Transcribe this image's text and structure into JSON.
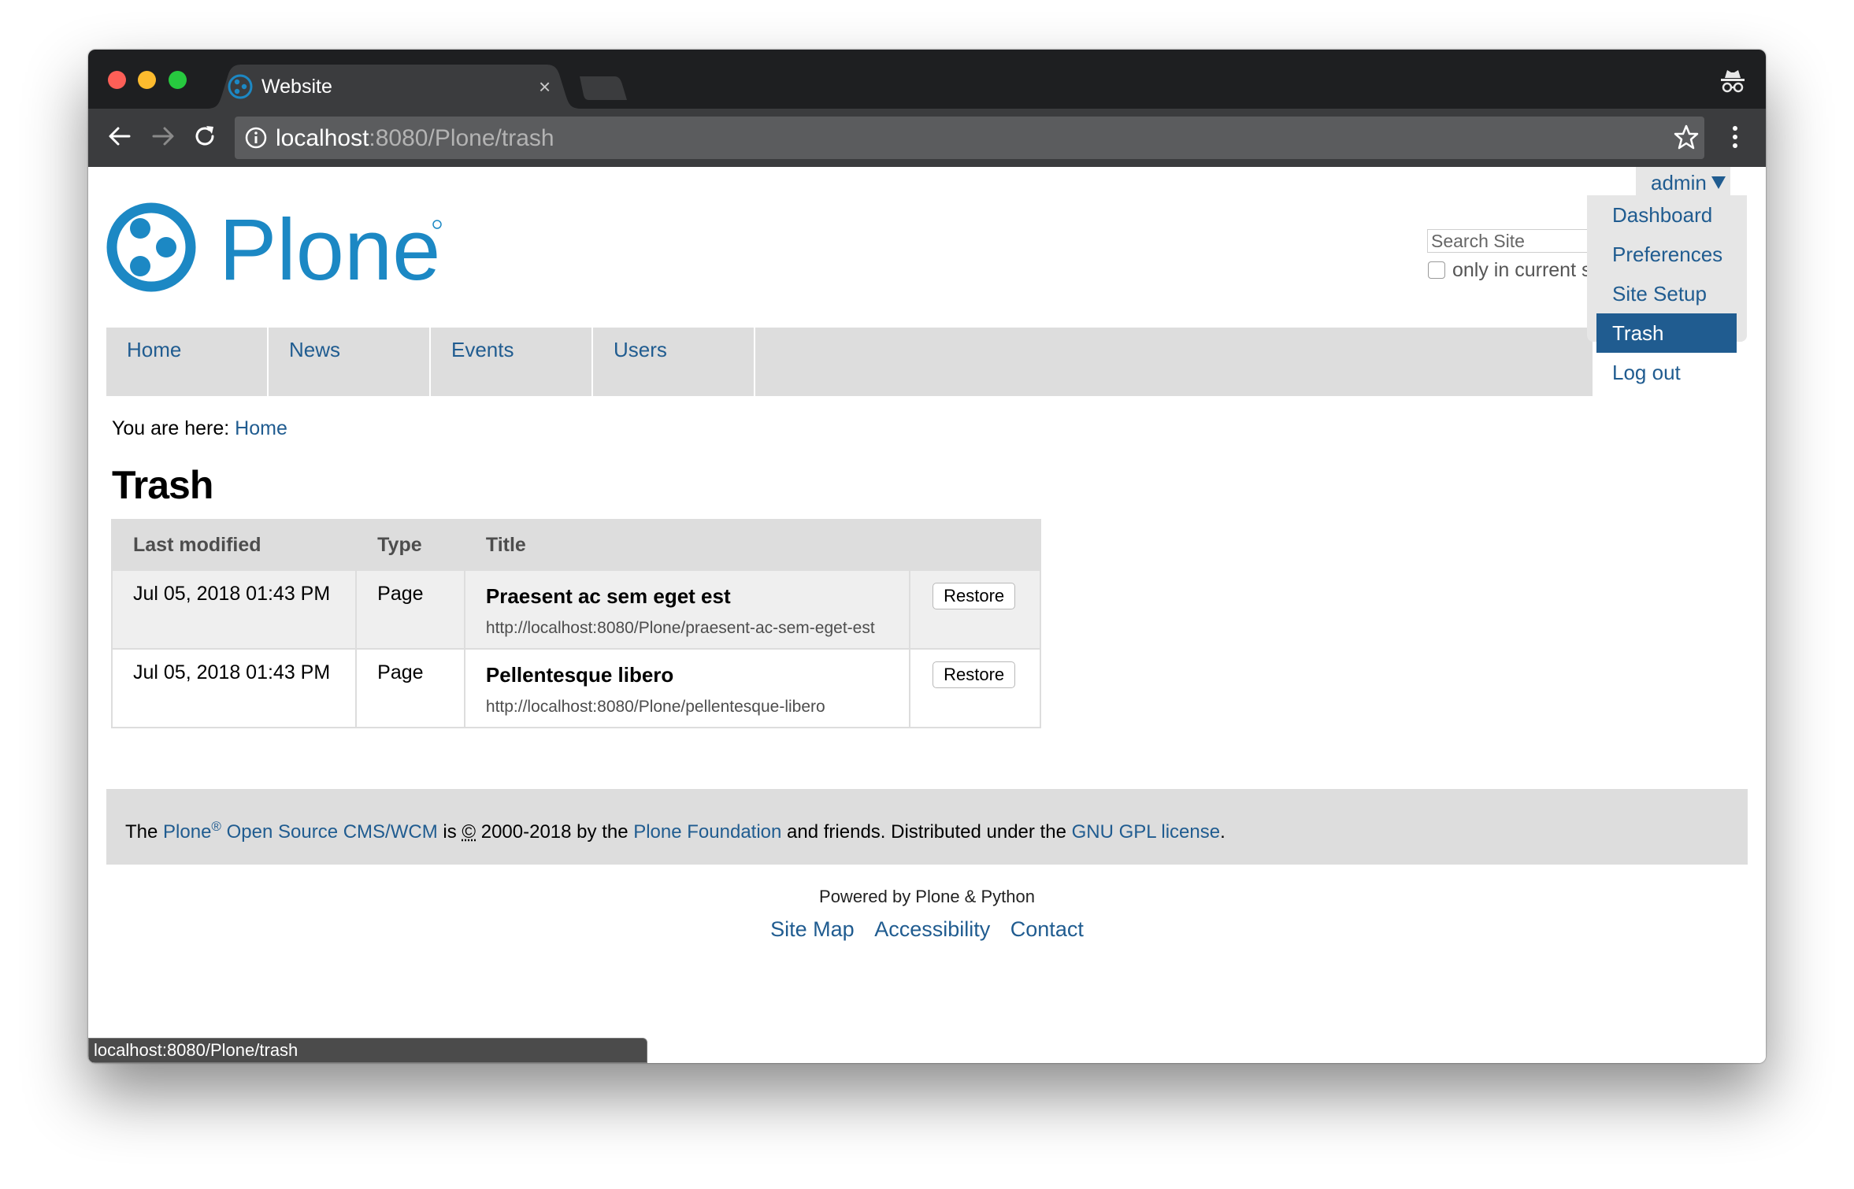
{
  "browser": {
    "tab_title": "Website",
    "tab_close": "×",
    "url_host": "localhost",
    "url_rest": ":8080/Plone/trash",
    "status_url": "localhost:8080/Plone/trash"
  },
  "user": {
    "name": "admin",
    "menu": [
      {
        "label": "Dashboard",
        "active": false
      },
      {
        "label": "Preferences",
        "active": false
      },
      {
        "label": "Site Setup",
        "active": false
      },
      {
        "label": "Trash",
        "active": true
      },
      {
        "label": "Log out",
        "active": false
      }
    ]
  },
  "search": {
    "placeholder": "Search Site",
    "only_current_label": "only in current section"
  },
  "logo_text": "Plone",
  "nav": [
    {
      "label": "Home",
      "active": true
    },
    {
      "label": "News",
      "active": false
    },
    {
      "label": "Events",
      "active": false
    },
    {
      "label": "Users",
      "active": false
    }
  ],
  "breadcrumb": {
    "prefix": "You are here:",
    "home": "Home"
  },
  "page_title": "Trash",
  "table": {
    "headers": [
      "Last modified",
      "Type",
      "Title",
      ""
    ],
    "rows": [
      {
        "modified": "Jul 05, 2018 01:43 PM",
        "type": "Page",
        "title": "Praesent ac sem eget est",
        "url": "http://localhost:8080/Plone/praesent-ac-sem-eget-est",
        "action": "Restore"
      },
      {
        "modified": "Jul 05, 2018 01:43 PM",
        "type": "Page",
        "title": "Pellentesque libero",
        "url": "http://localhost:8080/Plone/pellentesque-libero",
        "action": "Restore"
      }
    ]
  },
  "footer": {
    "t1": "The ",
    "plone": "Plone",
    "reg": "®",
    "oss": "Open Source CMS/WCM",
    "t2": " is ",
    "copy": "©",
    "t3": " 2000-2018 by the ",
    "foundation": "Plone Foundation",
    "t4": " and friends. Distributed under the ",
    "license": "GNU GPL license",
    "t5": ".",
    "powered": "Powered by Plone & Python",
    "links": [
      "Site Map",
      "Accessibility",
      "Contact"
    ]
  },
  "colors": {
    "accent": "#205c90",
    "logo_blue": "#1c88c4",
    "nav_bg": "#dddddd"
  }
}
